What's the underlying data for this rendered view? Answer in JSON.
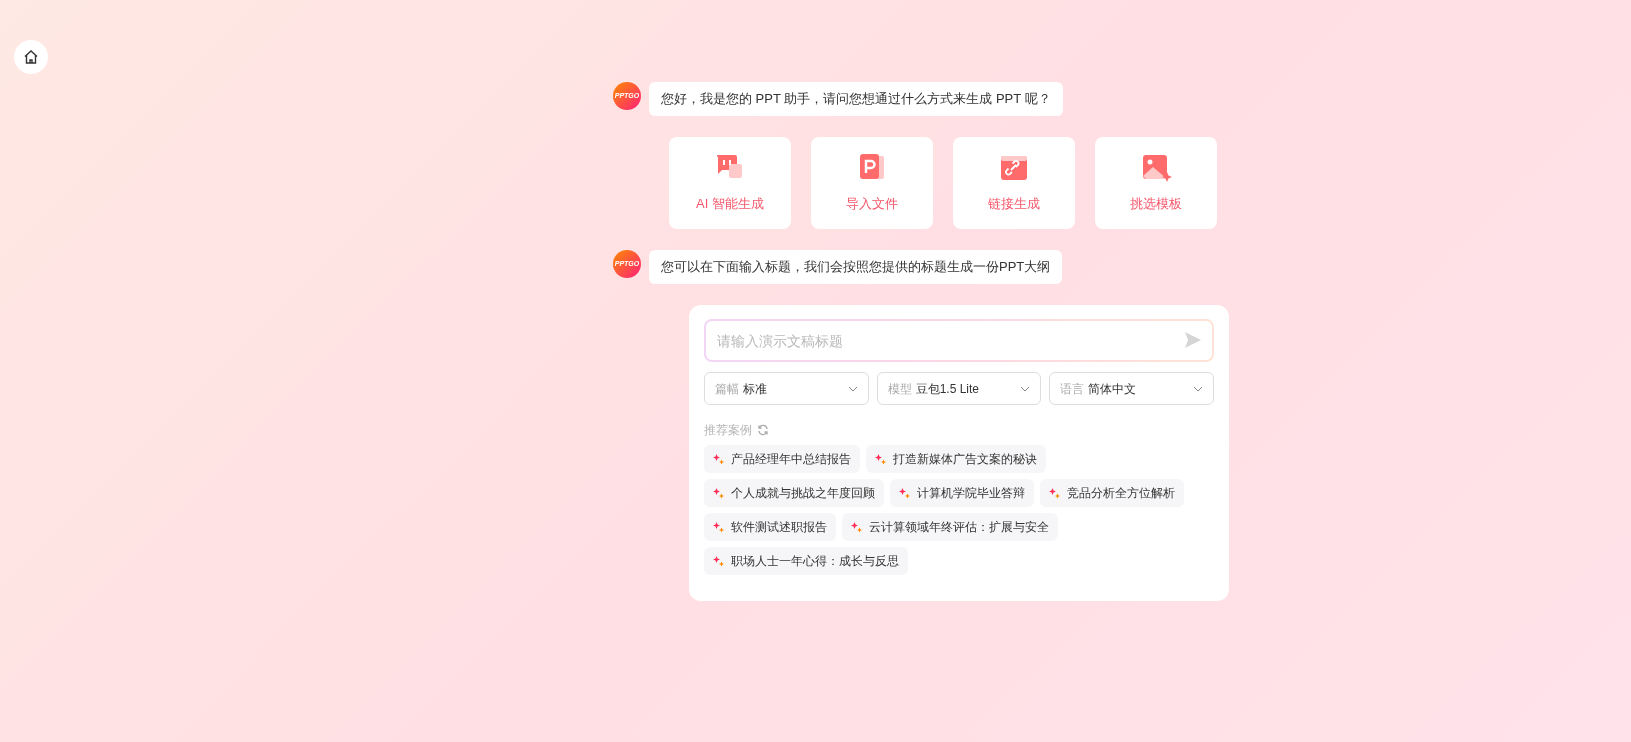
{
  "messages": [
    {
      "avatar": "PPTGO",
      "text": "您好，我是您的 PPT 助手，请问您想通过什么方式来生成 PPT 呢？"
    },
    {
      "avatar": "PPTGO",
      "text": "您可以在下面输入标题，我们会按照您提供的标题生成一份PPT大纲"
    }
  ],
  "options": [
    {
      "kind": "chat",
      "label": "AI 智能生成"
    },
    {
      "kind": "file",
      "label": "导入文件"
    },
    {
      "kind": "link",
      "label": "链接生成"
    },
    {
      "kind": "template",
      "label": "挑选模板"
    }
  ],
  "composer": {
    "placeholder": "请输入演示文稿标题",
    "selects": [
      {
        "label": "篇幅",
        "value": "标准"
      },
      {
        "label": "模型",
        "value": "豆包1.5 Lite"
      },
      {
        "label": "语言",
        "value": "简体中文"
      }
    ],
    "suggestions_title": "推荐案例",
    "suggestions": [
      [
        "产品经理年中总结报告",
        "打造新媒体广告文案的秘诀"
      ],
      [
        "个人成就与挑战之年度回顾",
        "计算机学院毕业答辩",
        "竞品分析全方位解析"
      ],
      [
        "软件测试述职报告",
        "云计算领域年终评估：扩展与安全"
      ],
      [
        "职场人士一年心得：成长与反思"
      ]
    ]
  }
}
